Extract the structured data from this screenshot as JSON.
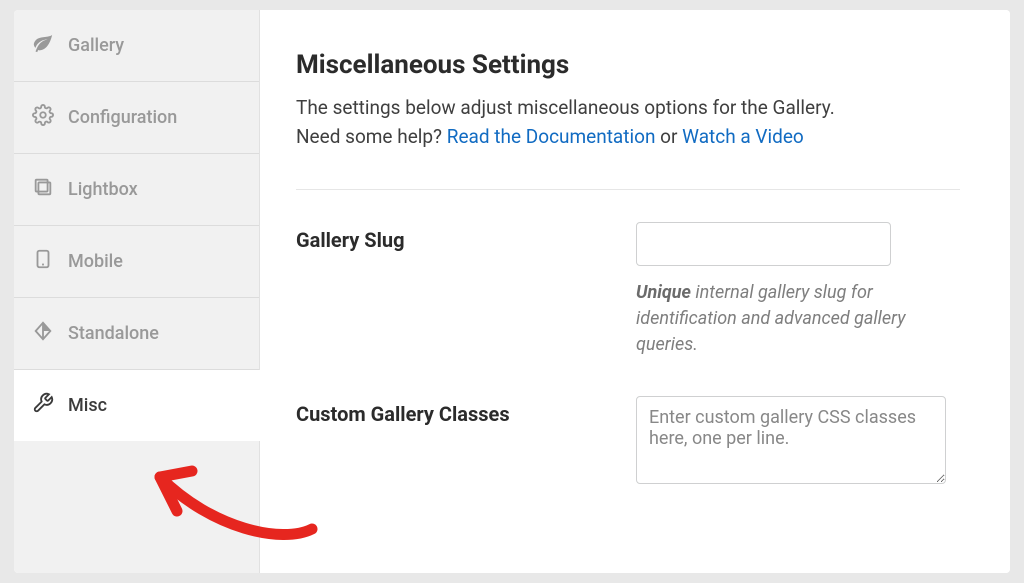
{
  "sidebar": {
    "items": [
      {
        "label": "Gallery"
      },
      {
        "label": "Configuration"
      },
      {
        "label": "Lightbox"
      },
      {
        "label": "Mobile"
      },
      {
        "label": "Standalone"
      },
      {
        "label": "Misc"
      }
    ]
  },
  "main": {
    "title": "Miscellaneous Settings",
    "desc_line1": "The settings below adjust miscellaneous options for the Gallery.",
    "desc_prefix": "Need some help? ",
    "link_docs": "Read the Documentation",
    "desc_or": " or ",
    "link_video": "Watch a Video",
    "fields": {
      "slug": {
        "label": "Gallery Slug",
        "help_strong": "Unique",
        "help_rest": " internal gallery slug for identification and advanced gallery queries."
      },
      "classes": {
        "label": "Custom Gallery Classes",
        "placeholder": "Enter custom gallery CSS classes here, one per line."
      }
    }
  }
}
